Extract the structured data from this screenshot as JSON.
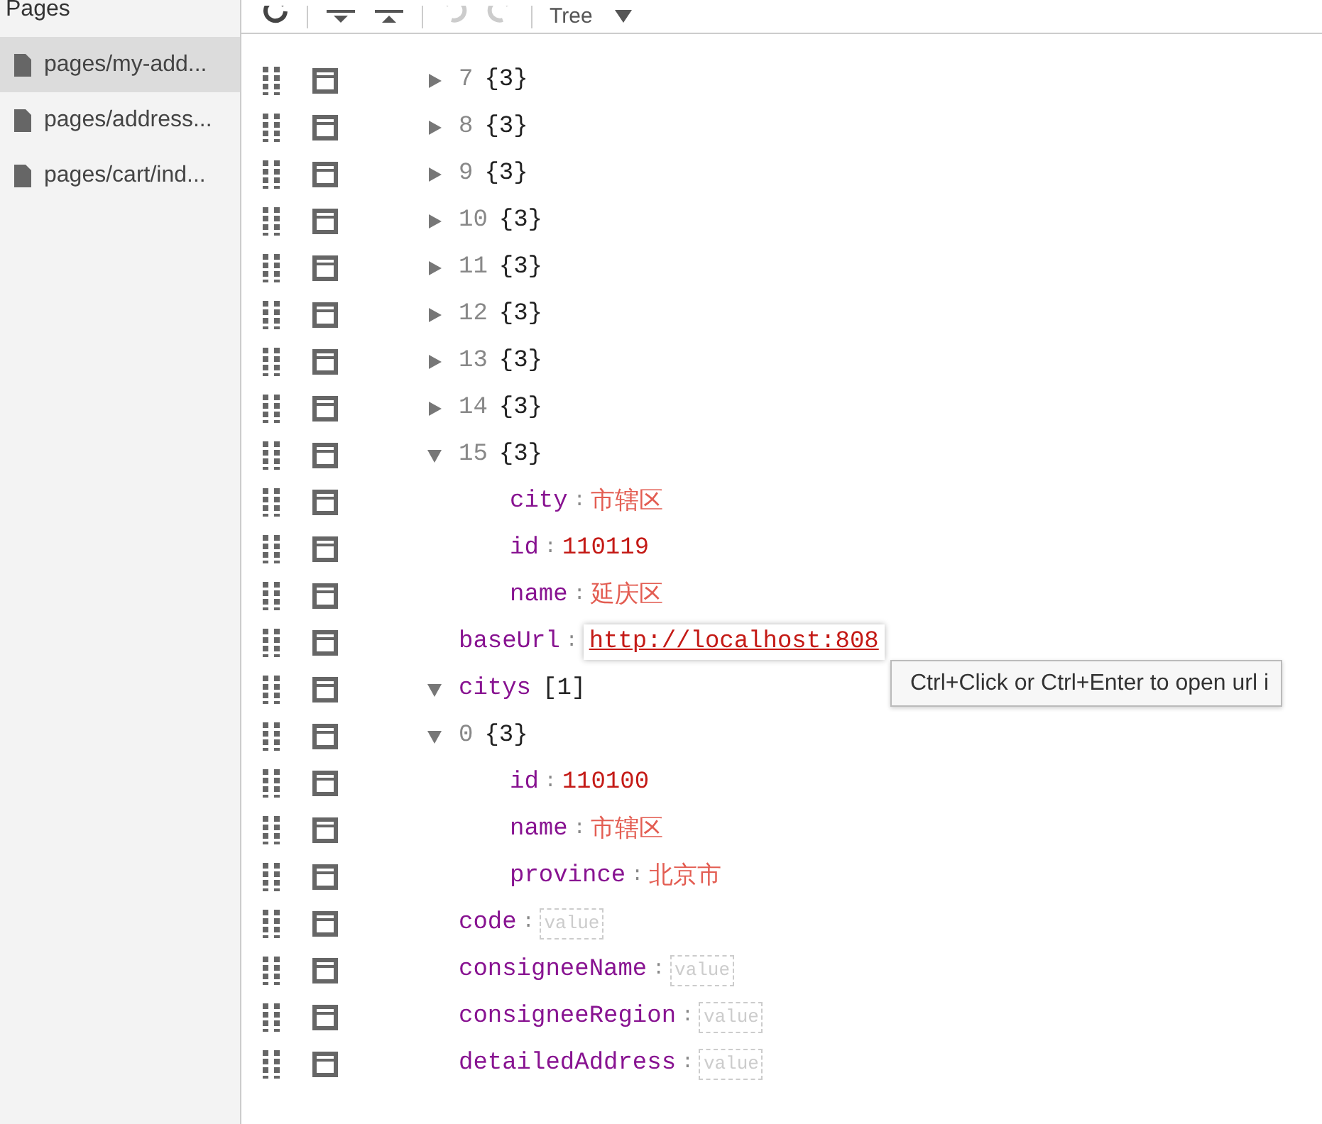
{
  "sidebar": {
    "title": "Pages",
    "items": [
      {
        "label": "pages/my-add...",
        "selected": true
      },
      {
        "label": "pages/address...",
        "selected": false
      },
      {
        "label": "pages/cart/ind...",
        "selected": false
      }
    ]
  },
  "toolbar": {
    "view_mode": "Tree"
  },
  "tree": [
    {
      "children": [
        {
          "key": "7",
          "kind": "object",
          "summary": "{3}",
          "expanded": false
        },
        {
          "key": "8",
          "kind": "object",
          "summary": "{3}",
          "expanded": false
        },
        {
          "key": "9",
          "kind": "object",
          "summary": "{3}",
          "expanded": false
        },
        {
          "key": "10",
          "kind": "object",
          "summary": "{3}",
          "expanded": false
        },
        {
          "key": "11",
          "kind": "object",
          "summary": "{3}",
          "expanded": false
        },
        {
          "key": "12",
          "kind": "object",
          "summary": "{3}",
          "expanded": false
        },
        {
          "key": "13",
          "kind": "object",
          "summary": "{3}",
          "expanded": false
        },
        {
          "key": "14",
          "kind": "object",
          "summary": "{3}",
          "expanded": false
        },
        {
          "key": "15",
          "kind": "object",
          "summary": "{3}",
          "expanded": true,
          "children": [
            {
              "key": "city",
              "separator": ":",
              "kind": "string",
              "value": "市辖区"
            },
            {
              "key": "id",
              "separator": ":",
              "kind": "number",
              "value": "110119"
            },
            {
              "key": "name",
              "separator": ":",
              "kind": "string",
              "value": "延庆区"
            }
          ]
        }
      ]
    },
    {
      "key": "baseUrl",
      "separator": ":",
      "kind": "link",
      "value": "http://localhost:808"
    },
    {
      "key": "citys",
      "kind": "array",
      "summary": "[1]",
      "expanded": true,
      "children": [
        {
          "key": "0",
          "kind": "object",
          "summary": "{3}",
          "expanded": true,
          "children": [
            {
              "key": "id",
              "separator": ":",
              "kind": "number",
              "value": "110100"
            },
            {
              "key": "name",
              "separator": ":",
              "kind": "string",
              "value": "市辖区"
            },
            {
              "key": "province",
              "separator": ":",
              "kind": "string",
              "value": "北京市"
            }
          ]
        }
      ]
    },
    {
      "key": "code",
      "separator": ":",
      "kind": "empty",
      "placeholder": "value"
    },
    {
      "key": "consigneeName",
      "separator": ":",
      "kind": "empty",
      "placeholder": "value"
    },
    {
      "key": "consigneeRegion",
      "separator": ":",
      "kind": "empty",
      "placeholder": "value"
    },
    {
      "key": "detailedAddress",
      "separator": ":",
      "kind": "empty",
      "placeholder": "value"
    }
  ],
  "tooltip": "Ctrl+Click or Ctrl+Enter to open url i"
}
